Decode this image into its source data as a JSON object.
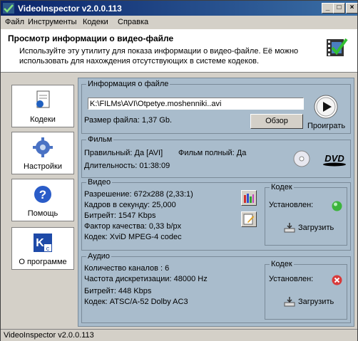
{
  "window": {
    "title": "VideoInspector v2.0.0.113"
  },
  "menu": [
    "Файл",
    "Инструменты",
    "Кодеки",
    "Справка"
  ],
  "header": {
    "title": "Просмотр информации о видео-файле",
    "description": "Используйте эту утилиту для показа информации о видео-файле. Её можно использовать для нахождения отсутствующих в системе кодеков."
  },
  "sidebar": {
    "items": [
      {
        "label": "Кодеки",
        "icon": "document-icon"
      },
      {
        "label": "Настройки",
        "icon": "gear-icon"
      },
      {
        "label": "Помощь",
        "icon": "help-icon"
      },
      {
        "label": "О программе",
        "icon": "about-icon"
      }
    ]
  },
  "file_info": {
    "title": "Информация о файле",
    "path": "K:\\FILMs\\AVI\\Otpetye.moshenniki..avi",
    "size_label": "Размер файла: 1,37 Gb.",
    "browse_label": "Обзор",
    "play_label": "Проиграть"
  },
  "film": {
    "title": "Фильм",
    "correct": "Правильный: Да [AVI]",
    "complete": "Фильм полный: Да",
    "duration": "Длительность: 01:38:09"
  },
  "video": {
    "title": "Видео",
    "resolution": "Разрешение: 672x288 (2,33:1)",
    "fps": "Кадров в секунду: 25,000",
    "bitrate": "Битрейт: 1547 Kbps",
    "quality": "Фактор качества: 0,33 b/px",
    "codec": "Кодек: XviD MPEG-4 codec"
  },
  "video_codec": {
    "title": "Кодек",
    "installed_label": "Установлен:",
    "installed_status": "ok",
    "download_label": "Загрузить"
  },
  "audio": {
    "title": "Аудио",
    "channels": "Количество каналов : 6",
    "sample_rate": "Частота дискретизации: 48000 Hz",
    "bitrate": "Битрейт: 448 Kbps",
    "codec": "Кодек: ATSC/A-52 Dolby AC3"
  },
  "audio_codec": {
    "title": "Кодек",
    "installed_label": "Установлен:",
    "installed_status": "error",
    "download_label": "Загрузить"
  },
  "statusbar": {
    "text": "VideoInspector v2.0.0.113"
  },
  "colors": {
    "titlebar_start": "#0a246a",
    "titlebar_end": "#3a6ea5",
    "panel_bg": "#a9bccc",
    "ok_green": "#3cb43c",
    "error_red": "#d83a3a"
  }
}
